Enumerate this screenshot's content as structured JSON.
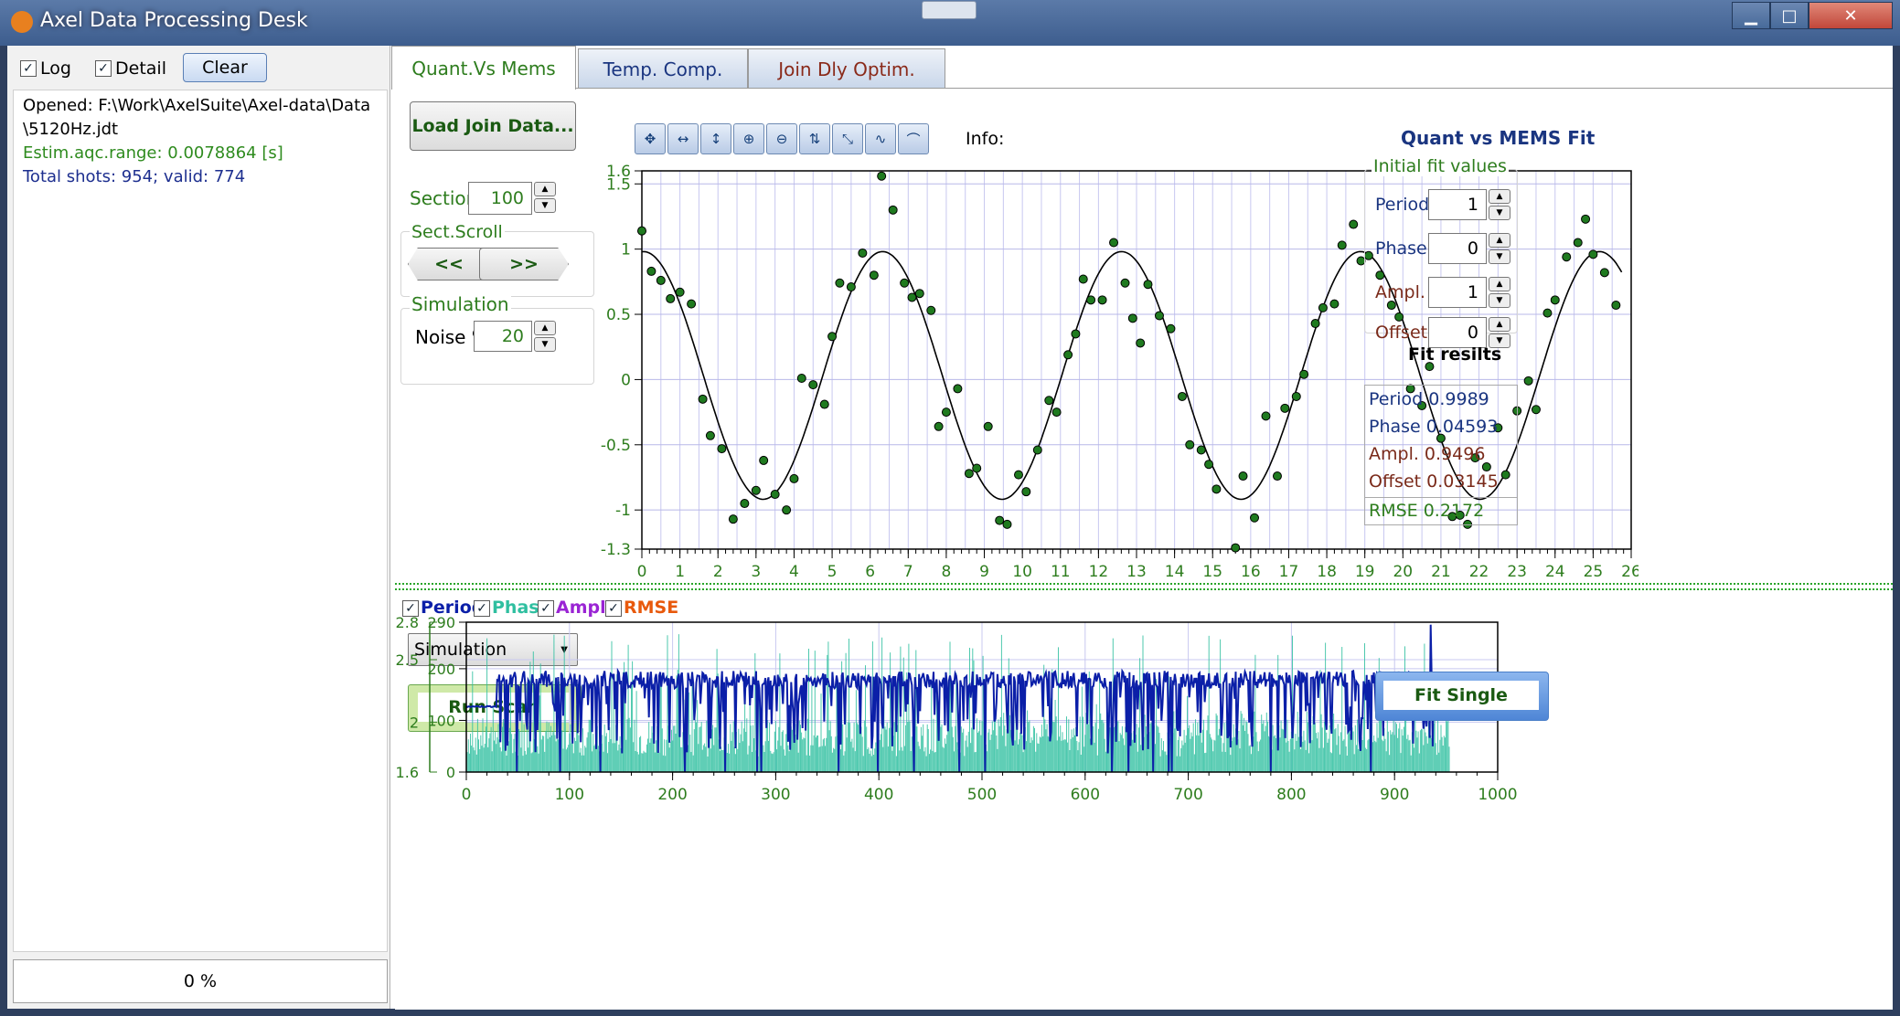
{
  "window": {
    "title": "Axel Data Processing Desk",
    "min": "▁",
    "max": "□",
    "close": "✕"
  },
  "log_panel": {
    "log_label": "Log",
    "detail_label": "Detail",
    "clear_label": "Clear",
    "check": "✓",
    "lines": [
      "Opened: F:\\Work\\AxelSuite\\Axel-data\\Data",
      "\\5120Hz.jdt",
      "Estim.aqc.range: 0.0078864 [s]",
      "Total shots: 954; valid: 774"
    ],
    "progress": "0 %"
  },
  "tabs": [
    "Quant.Vs Mems",
    "Temp. Comp.",
    "Join Dly Optim."
  ],
  "controls": {
    "load_button": "Load Join Data...",
    "section_label": "Section",
    "section_value": "100",
    "sect_scroll_label": "Sect.Scroll",
    "prev": "<<",
    "next": ">>",
    "simulation_label": "Simulation",
    "noise_label": "Noise %",
    "noise_value": "20",
    "mode_select": "Simulation",
    "run_scan": "Run Scan",
    "spin_up": "▲",
    "spin_down": "▼",
    "dropdown_arrow": "▼"
  },
  "toolbar": {
    "info_label": "Info:",
    "buttons": [
      "pan-all-icon",
      "pan-x-icon",
      "pan-y-icon",
      "zoom-in-icon",
      "zoom-out-icon",
      "fit-y-icon",
      "fit-xy-icon",
      "auto-scale-icon",
      "line-style-icon"
    ]
  },
  "fit_panel": {
    "title": "Quant vs MEMS Fit",
    "initial_label": "Initial fit values",
    "period_label": "Period",
    "period_value": "1",
    "phase_label": "Phase",
    "phase_value": "0",
    "ampl_label": "Ampl.",
    "ampl_value": "1",
    "offset_label": "Offset",
    "offset_value": "0",
    "results_title": "Fit resilts",
    "res_period": "Period  0.9989",
    "res_phase": "Phase  0.04593",
    "res_ampl": "Ampl.  0.9496",
    "res_offset": "Offset  0.03145",
    "res_rmse": "RMSE  0.2172",
    "fit_single": "Fit Single"
  },
  "colors": {
    "period": "#0b1fa8",
    "phase": "#2fbfa0",
    "ampl": "#9a24d4",
    "rmse": "#e8590c",
    "green_text": "#2e7d1e"
  },
  "legend": {
    "period": "Period",
    "phase": "Phase",
    "ampl": "Ampl.",
    "rmse": "RMSE"
  },
  "chart_data": [
    {
      "type": "scatter",
      "xlim": [
        0,
        26
      ],
      "ylim": [
        -1.3,
        1.6
      ],
      "x_ticks": [
        "0",
        "1",
        "2",
        "3",
        "4",
        "5",
        "6",
        "7",
        "8",
        "9",
        "10",
        "11",
        "12",
        "13",
        "14",
        "15",
        "16",
        "17",
        "18",
        "19",
        "20",
        "21",
        "22",
        "23",
        "24",
        "25",
        "26"
      ],
      "y_ticks": [
        {
          "v": 1.6,
          "t": "1.6"
        },
        {
          "v": 1.5,
          "t": "1.5"
        },
        {
          "v": 1,
          "t": "1"
        },
        {
          "v": 0.5,
          "t": "0.5"
        },
        {
          "v": 0,
          "t": "0"
        },
        {
          "v": -0.5,
          "t": "-0.5"
        },
        {
          "v": -1,
          "t": "-1"
        },
        {
          "v": -1.3,
          "t": "-1.3"
        }
      ],
      "fit": {
        "period": 6.28,
        "phase": 0.04593,
        "amplitude": 0.9496,
        "offset": 0.03145
      },
      "points": [
        [
          0,
          1.14
        ],
        [
          0.25,
          0.83
        ],
        [
          0.5,
          0.76
        ],
        [
          0.75,
          0.62
        ],
        [
          1,
          0.67
        ],
        [
          1.3,
          0.58
        ],
        [
          1.6,
          -0.15
        ],
        [
          1.8,
          -0.43
        ],
        [
          2.1,
          -0.53
        ],
        [
          2.4,
          -1.07
        ],
        [
          2.7,
          -0.95
        ],
        [
          3,
          -0.85
        ],
        [
          3.2,
          -0.62
        ],
        [
          3.5,
          -0.88
        ],
        [
          3.8,
          -1.0
        ],
        [
          4.0,
          -0.76
        ],
        [
          4.2,
          0.01
        ],
        [
          4.5,
          -0.04
        ],
        [
          4.8,
          -0.19
        ],
        [
          5.0,
          0.33
        ],
        [
          5.2,
          0.74
        ],
        [
          5.5,
          0.71
        ],
        [
          5.8,
          0.97
        ],
        [
          6.1,
          0.8
        ],
        [
          6.3,
          1.56
        ],
        [
          6.6,
          1.3
        ],
        [
          6.9,
          0.74
        ],
        [
          7.1,
          0.63
        ],
        [
          7.3,
          0.66
        ],
        [
          7.6,
          0.53
        ],
        [
          7.8,
          -0.36
        ],
        [
          8.0,
          -0.25
        ],
        [
          8.3,
          -0.07
        ],
        [
          8.6,
          -0.72
        ],
        [
          8.8,
          -0.68
        ],
        [
          9.1,
          -0.36
        ],
        [
          9.4,
          -1.08
        ],
        [
          9.6,
          -1.11
        ],
        [
          9.9,
          -0.73
        ],
        [
          10.1,
          -0.86
        ],
        [
          10.4,
          -0.54
        ],
        [
          10.7,
          -0.16
        ],
        [
          10.9,
          -0.25
        ],
        [
          11.2,
          0.19
        ],
        [
          11.4,
          0.35
        ],
        [
          11.6,
          0.77
        ],
        [
          11.8,
          0.61
        ],
        [
          12.1,
          0.61
        ],
        [
          12.4,
          1.05
        ],
        [
          12.7,
          0.74
        ],
        [
          12.9,
          0.47
        ],
        [
          13.1,
          0.28
        ],
        [
          13.3,
          0.73
        ],
        [
          13.6,
          0.49
        ],
        [
          13.9,
          0.39
        ],
        [
          14.2,
          -0.13
        ],
        [
          14.4,
          -0.5
        ],
        [
          14.7,
          -0.54
        ],
        [
          14.9,
          -0.65
        ],
        [
          15.1,
          -0.84
        ],
        [
          15.6,
          -1.29
        ],
        [
          15.8,
          -0.74
        ],
        [
          16.1,
          -1.06
        ],
        [
          16.4,
          -0.28
        ],
        [
          16.7,
          -0.74
        ],
        [
          16.9,
          -0.22
        ],
        [
          17.2,
          -0.13
        ],
        [
          17.4,
          0.04
        ],
        [
          17.7,
          0.43
        ],
        [
          17.9,
          0.55
        ],
        [
          18.2,
          0.58
        ],
        [
          18.4,
          1.03
        ],
        [
          18.7,
          1.19
        ],
        [
          18.9,
          0.91
        ],
        [
          19.1,
          0.95
        ],
        [
          19.4,
          0.8
        ],
        [
          19.7,
          0.57
        ],
        [
          19.9,
          0.48
        ],
        [
          20.2,
          -0.07
        ],
        [
          20.5,
          -0.2
        ],
        [
          20.7,
          0.1
        ],
        [
          21.0,
          -0.45
        ],
        [
          21.3,
          -1.05
        ],
        [
          21.5,
          -1.04
        ],
        [
          21.7,
          -1.11
        ],
        [
          21.9,
          -0.6
        ],
        [
          22.2,
          -0.67
        ],
        [
          22.5,
          -0.37
        ],
        [
          22.7,
          -0.73
        ],
        [
          23.0,
          -0.24
        ],
        [
          23.3,
          -0.01
        ],
        [
          23.5,
          -0.23
        ],
        [
          23.8,
          0.51
        ],
        [
          24.0,
          0.61
        ],
        [
          24.3,
          0.94
        ],
        [
          24.6,
          1.05
        ],
        [
          24.8,
          1.23
        ],
        [
          25.0,
          0.96
        ],
        [
          25.3,
          0.82
        ],
        [
          25.6,
          0.57
        ]
      ]
    },
    {
      "type": "line",
      "xlim": [
        0,
        1000
      ],
      "x_ticks": [
        "0",
        "100",
        "200",
        "300",
        "400",
        "500",
        "600",
        "700",
        "800",
        "900",
        "1000"
      ],
      "y_left_outer": {
        "range": [
          1.6,
          2.8
        ],
        "ticks": [
          {
            "v": 2.8,
            "t": "2.8"
          },
          {
            "v": 2.5,
            "t": "2.5"
          },
          {
            "v": 2,
            "t": "2"
          },
          {
            "v": 1.6,
            "t": "1.6"
          }
        ]
      },
      "y_left_inner": {
        "range": [
          0,
          290
        ],
        "ticks": [
          {
            "v": 290,
            "t": "290"
          },
          {
            "v": 200,
            "t": "200"
          },
          {
            "v": 100,
            "t": "100"
          },
          {
            "v": 0,
            "t": "0"
          }
        ]
      },
      "series": [
        {
          "name": "Period",
          "approx_range": [
            1.6,
            2.78
          ],
          "typical": 2.2,
          "n": 954
        },
        {
          "name": "Phase",
          "approx_range": [
            0,
            270
          ],
          "typical": 100,
          "n": 954
        }
      ]
    }
  ]
}
